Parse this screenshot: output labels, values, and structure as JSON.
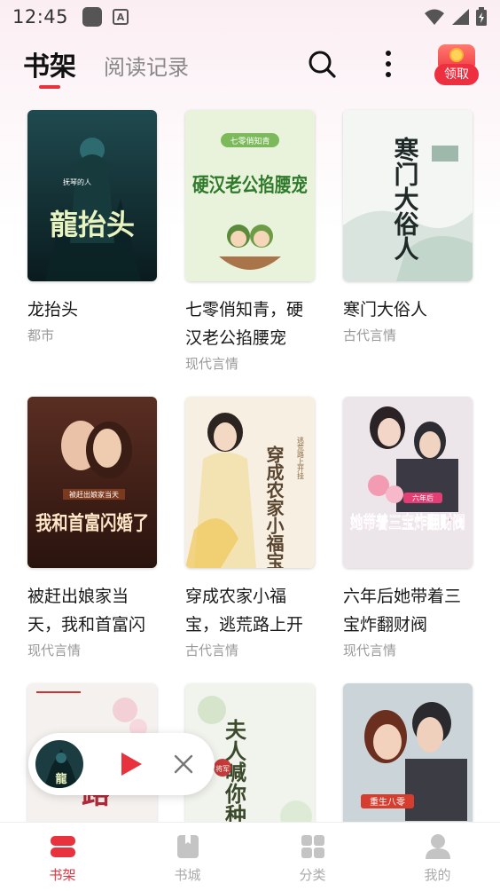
{
  "status_bar": {
    "time": "12:45",
    "icons": [
      "notification-square-icon",
      "a-badge-icon",
      "wifi-icon",
      "signal-icon",
      "battery-icon"
    ]
  },
  "header": {
    "tabs": [
      {
        "label": "书架",
        "active": true
      },
      {
        "label": "阅读记录",
        "active": false
      }
    ],
    "search_icon": "search-icon",
    "more_icon": "more-vertical-icon",
    "reward": {
      "label": "领取",
      "icon": "red-packet-icon"
    }
  },
  "books": [
    {
      "title": "龙抬头",
      "genre": "都市",
      "cover_text": "龍抬头",
      "cover_sub": "抚琴的人"
    },
    {
      "title": "七零俏知青，硬汉老公掐腰宠",
      "genre": "现代言情",
      "cover_text": "硬汉老公掐腰宠",
      "cover_sub": "七零俏知青"
    },
    {
      "title": "寒门大俗人",
      "genre": "古代言情",
      "cover_text": "寒门大俗人",
      "cover_sub": ""
    },
    {
      "title": "被赶出娘家当天，我和首富闪",
      "genre": "现代言情",
      "cover_text": "我和首富闪婚了",
      "cover_sub": "被赶出娘家当天"
    },
    {
      "title": "穿成农家小福宝，逃荒路上开",
      "genre": "古代言情",
      "cover_text": "穿成农家小福宝",
      "cover_sub": "逃荒路上开挂"
    },
    {
      "title": "六年后她带着三宝炸翻财阀",
      "genre": "现代言情",
      "cover_text": "她带着三宝炸翻财阀",
      "cover_sub": "六年后"
    },
    {
      "title": "",
      "genre": "",
      "cover_text": "诰路",
      "cover_sub": ""
    },
    {
      "title": "",
      "genre": "",
      "cover_text": "夫人喊你种田了",
      "cover_sub": "将军"
    },
    {
      "title": "",
      "genre": "",
      "cover_text": "重生八零",
      "cover_sub": ""
    }
  ],
  "mini_player": {
    "play_icon": "play-icon",
    "close_icon": "close-icon"
  },
  "bottom_nav": [
    {
      "label": "书架",
      "icon": "bookshelf-icon",
      "active": true
    },
    {
      "label": "书城",
      "icon": "book-store-icon",
      "active": false
    },
    {
      "label": "分类",
      "icon": "category-grid-icon",
      "active": false
    },
    {
      "label": "我的",
      "icon": "profile-icon",
      "active": false
    }
  ],
  "colors": {
    "accent": "#e8333f",
    "inactive": "#aaaaaa",
    "genre": "#999999"
  }
}
